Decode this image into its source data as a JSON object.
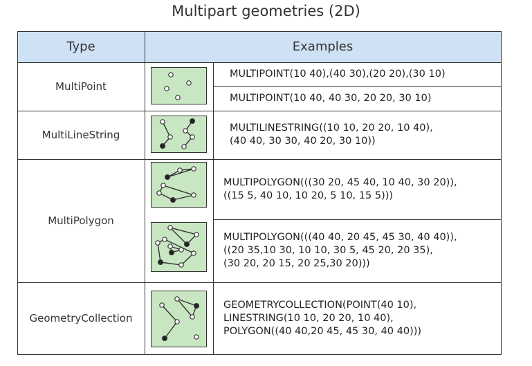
{
  "title": "Multipart geometries (2D)",
  "header": {
    "type": "Type",
    "examples": "Examples"
  },
  "rows": [
    {
      "type": "MultiPoint",
      "examples": [
        [
          "MULTIPOINT(10 40),(40 30),(20 20),(30 10)"
        ],
        [
          "MULTIPOINT(10 40, 40 30, 20 20, 30 10)"
        ]
      ]
    },
    {
      "type": "MultiLineString",
      "examples": [
        [
          "MULTILINESTRING((10 10, 20 20, 10 40),",
          "(40 40, 30 30, 40 20, 30 10))"
        ]
      ]
    },
    {
      "type": "MultiPolygon",
      "examples": [
        [
          "MULTIPOLYGON(((30 20, 45 40, 10 40, 30 20)),",
          "((15 5, 40 10, 10 20, 5 10, 15 5)))"
        ],
        [
          "MULTIPOLYGON(((40 40, 20 45, 45 30, 40 40)),",
          "((20 35,10 30, 10 10, 30 5, 45 20, 20 35),",
          "(30 20, 20 15, 20 25,30 20)))"
        ]
      ]
    },
    {
      "type": "GeometryCollection",
      "examples": [
        [
          "GEOMETRYCOLLECTION(POINT(40 10),",
          "LINESTRING(10 10, 20 20, 10 40),",
          "POLYGON((40 40,20 45, 45 30, 40 40)))"
        ]
      ]
    }
  ],
  "colors": {
    "header_bg": "#cfe2f5",
    "thumb_bg": "#c8e6c2",
    "border": "#333333"
  }
}
